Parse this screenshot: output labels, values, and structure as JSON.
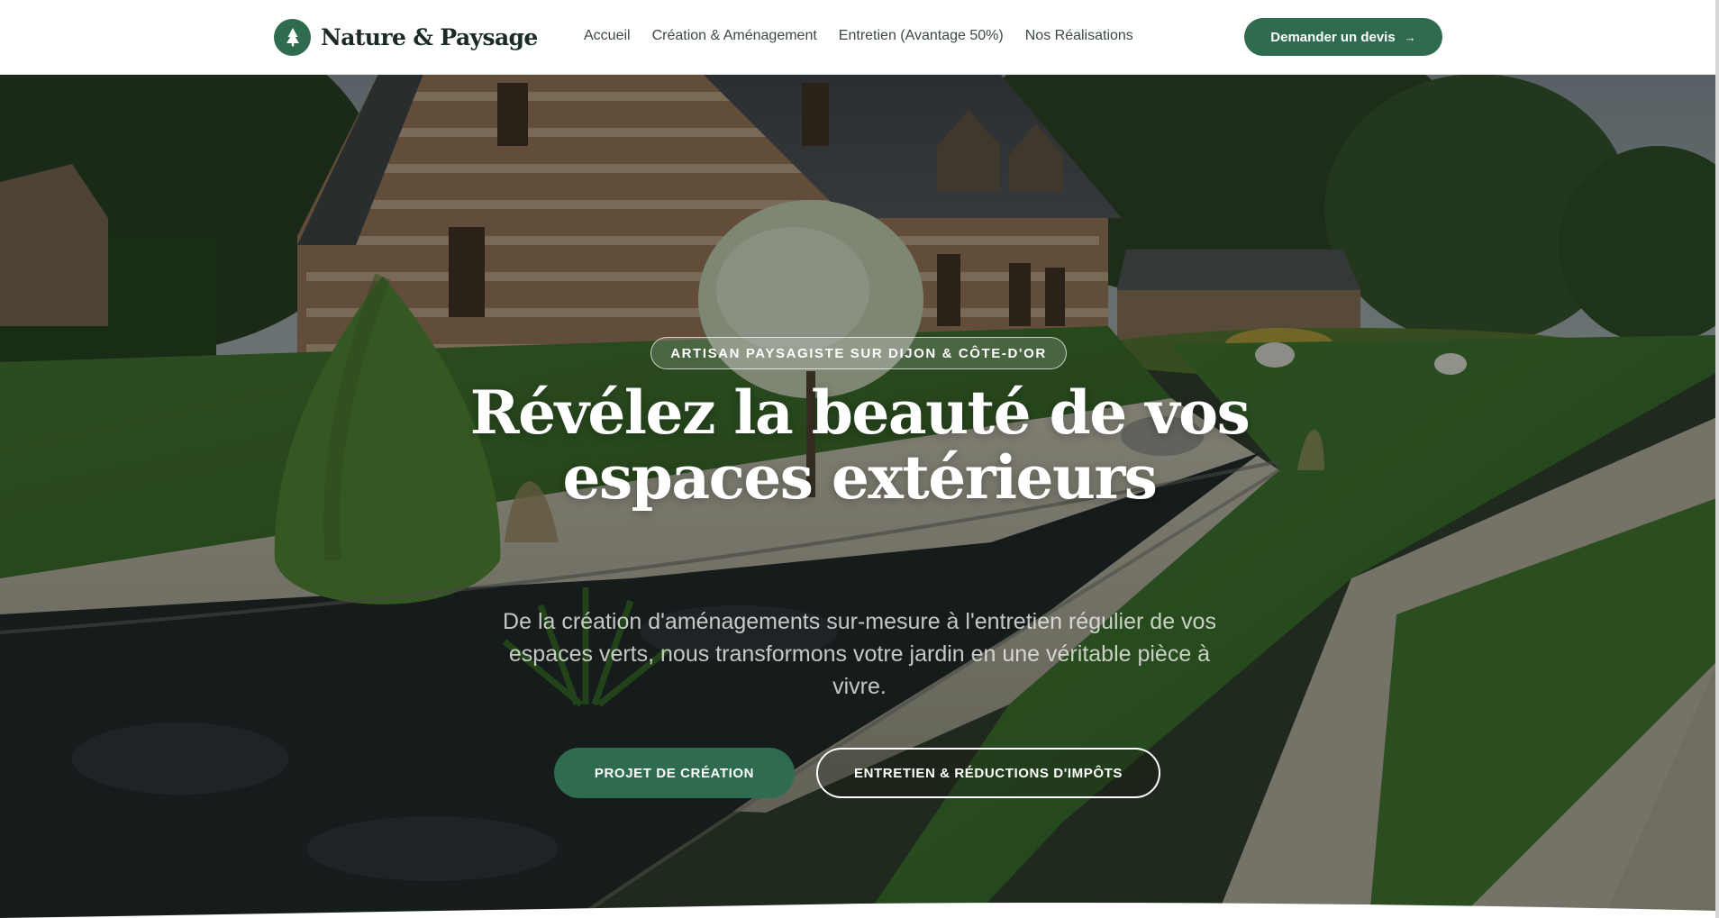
{
  "brand": {
    "name": "Nature & Paysage",
    "logo_icon": "pine-tree-icon",
    "accent": "#2f6b4f"
  },
  "nav": {
    "items": [
      {
        "label": "Accueil"
      },
      {
        "label": "Création & Aménagement"
      },
      {
        "label": "Entretien (Avantage 50%)"
      },
      {
        "label": "Nos Réalisations"
      }
    ],
    "cta_label": "Demander un devis",
    "cta_icon": "arrow-right-icon"
  },
  "hero": {
    "eyebrow": "ARTISAN PAYSAGISTE SUR DIJON & CÔTE-D'OR",
    "title_line1": "Révélez la beauté de vos",
    "title_line2": "espaces extérieurs",
    "subtitle": "De la création d'aménagements sur-mesure à l'entretien régulier de vos espaces verts, nous transformons votre jardin en une véritable pièce à vivre.",
    "primary_button": "PROJET DE CRÉATION",
    "secondary_button": "ENTRETIEN & RÉDUCTIONS D'IMPÔTS"
  }
}
